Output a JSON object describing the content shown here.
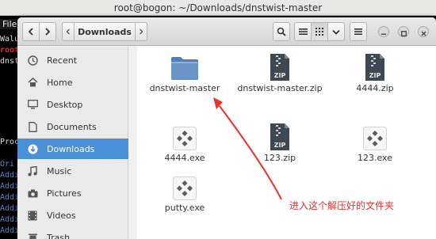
{
  "terminal": {
    "title": "root@bogon: ~/Downloads/dnstwist-master",
    "menu_label": "File",
    "lines": [
      "Walu",
      "root",
      "dnst",
      "",
      "",
      "Proc",
      "Ori",
      "Addi",
      "Addi",
      "Addi",
      "Addi",
      "Addi",
      "Addi",
      "Addi"
    ]
  },
  "toolbar": {
    "path_segment": "Downloads"
  },
  "sidebar": {
    "items": [
      {
        "label": "Recent",
        "icon": "clock-icon"
      },
      {
        "label": "Home",
        "icon": "home-icon"
      },
      {
        "label": "Desktop",
        "icon": "desktop-icon"
      },
      {
        "label": "Documents",
        "icon": "document-icon"
      },
      {
        "label": "Downloads",
        "icon": "download-icon",
        "active": true
      },
      {
        "label": "Music",
        "icon": "music-icon"
      },
      {
        "label": "Pictures",
        "icon": "camera-icon"
      },
      {
        "label": "Videos",
        "icon": "video-icon"
      },
      {
        "label": "Trash",
        "icon": "trash-icon"
      }
    ]
  },
  "files": [
    {
      "name": "dnstwist-master",
      "type": "folder"
    },
    {
      "name": "dnstwist-master.zip",
      "type": "zip"
    },
    {
      "name": "4444.zip",
      "type": "zip"
    },
    {
      "name": "4444.exe",
      "type": "exe"
    },
    {
      "name": "123.zip",
      "type": "zip"
    },
    {
      "name": "123.exe",
      "type": "exe"
    },
    {
      "name": "putty.exe",
      "type": "exe"
    }
  ],
  "annotation": {
    "text": "进入这个解压好的文件夹",
    "color": "#e8312f"
  },
  "colors": {
    "accent": "#4a90d9",
    "folder": "#6a94c5"
  }
}
